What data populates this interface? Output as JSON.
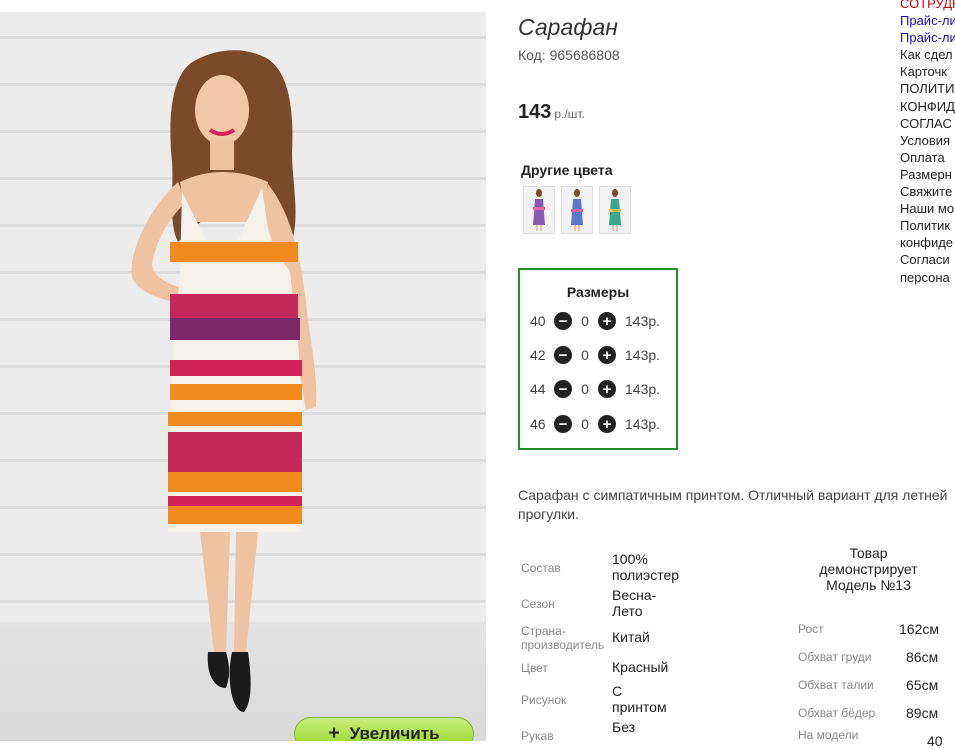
{
  "product": {
    "title": "Сарафан",
    "code": "Код: 965686808",
    "price": "143",
    "price_unit": "р./шт."
  },
  "colors": {
    "title": "Другие цвета",
    "thumbnails": [
      "dress-purple",
      "dress-blue",
      "dress-green"
    ]
  },
  "sizes": {
    "title": "Размеры",
    "rows": [
      {
        "size": "40",
        "qty": "0",
        "price": "143р."
      },
      {
        "size": "42",
        "qty": "0",
        "price": "143р."
      },
      {
        "size": "44",
        "qty": "0",
        "price": "143р."
      },
      {
        "size": "46",
        "qty": "0",
        "price": "143р."
      }
    ]
  },
  "description": "Сарафан с симпатичным принтом. Отличный вариант для летней прогулки.",
  "attributes": [
    {
      "label": "Состав",
      "value": "100% полиэстер"
    },
    {
      "label": "Сезон",
      "value": "Весна-Лето"
    },
    {
      "label": "Страна-производитель",
      "value": "Китай"
    },
    {
      "label": "Цвет",
      "value": "Красный"
    },
    {
      "label": "Рисунок",
      "value": "С принтом"
    },
    {
      "label": "Рукав",
      "value": "Без"
    }
  ],
  "model": {
    "heading": "Товар демонстрирует Модель №13",
    "params": [
      {
        "label": "Рост",
        "value": "162см"
      },
      {
        "label": "Обхват груди",
        "value": "86см"
      },
      {
        "label": "Обхват талии",
        "value": "65см"
      },
      {
        "label": "Обхват бёдер",
        "value": "89см"
      },
      {
        "label": "На модели",
        "value": "40"
      }
    ]
  },
  "zoom_button": {
    "label": "Увеличить",
    "icon": "+"
  },
  "menu": [
    {
      "text": "СОТРУДН",
      "color": "#d00000"
    },
    {
      "text": "Прайс-ли",
      "color": "#1a0dab"
    },
    {
      "text": "Прайс-ли",
      "color": "#1a0dab"
    },
    {
      "text": "Как сдел",
      "color": "#222222"
    },
    {
      "text": "Карточк",
      "color": "#222222"
    },
    {
      "text": "ПОЛИТИ",
      "color": "#222222"
    },
    {
      "text": "КОНФИД",
      "color": "#222222"
    },
    {
      "text": "СОГЛАС",
      "color": "#222222"
    },
    {
      "text": "Условия",
      "color": "#222222"
    },
    {
      "text": "Оплата",
      "color": "#222222"
    },
    {
      "text": "Размерн",
      "color": "#222222"
    },
    {
      "text": "Свяжите",
      "color": "#222222"
    },
    {
      "text": "Наши мо",
      "color": "#222222"
    },
    {
      "text": "Политик",
      "color": "#222222"
    },
    {
      "text": "конфиде",
      "color": "#222222"
    },
    {
      "text": "Согласи",
      "color": "#222222"
    },
    {
      "text": "персона",
      "color": "#222222"
    }
  ],
  "colors_palette": {
    "accent_green": "#2a8a2a",
    "button_green": "#92d22a",
    "link_blue": "#1a0dab",
    "alert_red": "#d00000"
  }
}
